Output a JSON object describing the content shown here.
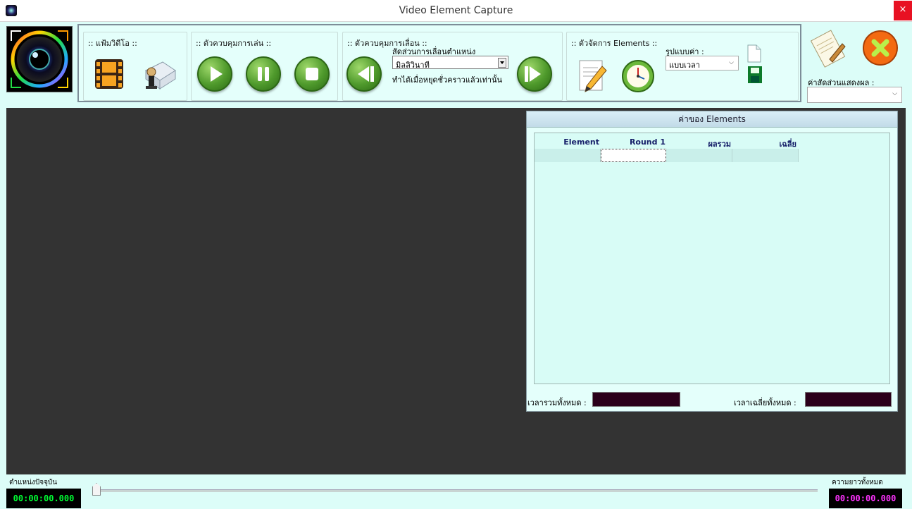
{
  "window": {
    "title": "Video Element Capture",
    "close_glyph": "×"
  },
  "toolbar": {
    "groups": {
      "video_file": {
        "label": ":: แฟ้มวิดีโอ ::"
      },
      "play_control": {
        "label": ":: ตัวควบคุมการเล่น ::"
      },
      "seek_control": {
        "label": ":: ตัวควบคุมการเลื่อน ::",
        "ratio_label": "สัดส่วนการเลื่อนตำแหน่ง",
        "ratio_value": "มิลลิวินาที",
        "note": "ทำได้เมื่อหยุดชั่วคราวแล้วเท่านั้น"
      },
      "elements": {
        "label": ":: ตัวจัดการ Elements ::",
        "format_label": "รูปแบบค่า :",
        "format_value": "แบบเวลา"
      }
    },
    "display_ratio_label": "ค่าสัดส่วนแสดงผล :",
    "display_ratio_value": ""
  },
  "panel": {
    "title": "ค่าของ Elements",
    "columns": [
      "Element",
      "Round 1",
      "ผลรวม",
      "เฉลี่ย"
    ],
    "total_label": "เวลารวมทั้งหมด :",
    "total_value": "",
    "average_label": "เวลาเฉลี่ยทั้งหมด :",
    "average_value": ""
  },
  "bottom": {
    "current_label": "ตำแหน่งปัจจุบัน",
    "current_time": "00:00:00.000",
    "length_label": "ความยาวทั้งหมด",
    "length_time": "00:00:00.000",
    "progress": 0
  },
  "colors": {
    "background": "#dcfdf8",
    "video_area": "#333333",
    "current_time_text": "#00ff33",
    "length_time_text": "#ff33ff",
    "close_red": "#e81123",
    "play_green": "#4f9a2c"
  },
  "icons": {
    "logo": "camera-lens-icon",
    "open_video": "film-strip-icon",
    "clear_video": "folder-remove-icon",
    "play": "play-icon",
    "pause": "pause-icon",
    "stop": "stop-icon",
    "step_back": "step-back-icon",
    "step_forward": "step-forward-icon",
    "edit": "edit-note-icon",
    "capture_time": "clock-icon",
    "new": "new-file-icon",
    "save": "save-disk-icon",
    "about": "notepad-icon",
    "exit": "exit-icon"
  }
}
